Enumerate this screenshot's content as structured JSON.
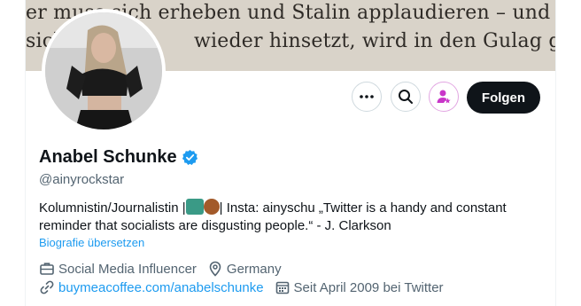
{
  "banner": {
    "line1": "er muss sich erheben und Stalin applaudieren – und der j",
    "line2": "sich",
    "line3": "wieder hinsetzt, wird in den Gulag gesch"
  },
  "actions": {
    "more_icon": "more-horizontal-icon",
    "search_icon": "search-icon",
    "subscribe_icon": "person-star-icon",
    "follow_label": "Folgen"
  },
  "profile": {
    "name": "Anabel Schunke",
    "handle": "@ainyrockstar",
    "bio_line1_part1": "Kolumnistin/Journalistin |",
    "bio_line1_part2": "| Insta: ainyschu „Twitter is a handy and constant",
    "bio_line2": "reminder that socialists are disgusting people.“ - J. Clarkson",
    "translate": "Biografie übersetzen",
    "category": "Social Media Influencer",
    "location": "Germany",
    "website": "buymeacoffee.com/anabelschunke",
    "joined": "Seit April 2009 bei Twitter"
  },
  "colors": {
    "accent": "#1d9bf0",
    "follow_bg": "#0f1419",
    "subscribe_accent": "#c936c9"
  }
}
